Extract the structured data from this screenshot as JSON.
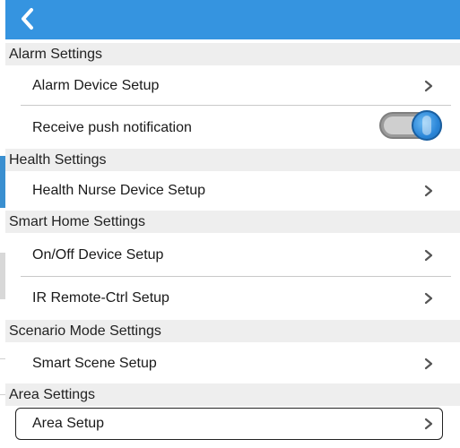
{
  "colors": {
    "header": "#3594e0",
    "section_bg": "#eeeeee",
    "toggle_knob": "#2b86d8"
  },
  "header": {
    "back_icon": "chevron-left-icon"
  },
  "alarm": {
    "section": "Alarm Settings",
    "device_setup": "Alarm Device Setup",
    "push_label": "Receive push notification",
    "push_enabled": true
  },
  "health": {
    "section": "Health Settings",
    "nurse_setup": "Health Nurse Device Setup"
  },
  "smart_home": {
    "section": "Smart Home Settings",
    "onoff_setup": "On/Off Device Setup",
    "ir_setup": "IR Remote-Ctrl Setup"
  },
  "scenario": {
    "section": "Scenario Mode Settings",
    "scene_setup": "Smart Scene Setup"
  },
  "area": {
    "section": "Area Settings",
    "area_setup": "Area Setup"
  }
}
